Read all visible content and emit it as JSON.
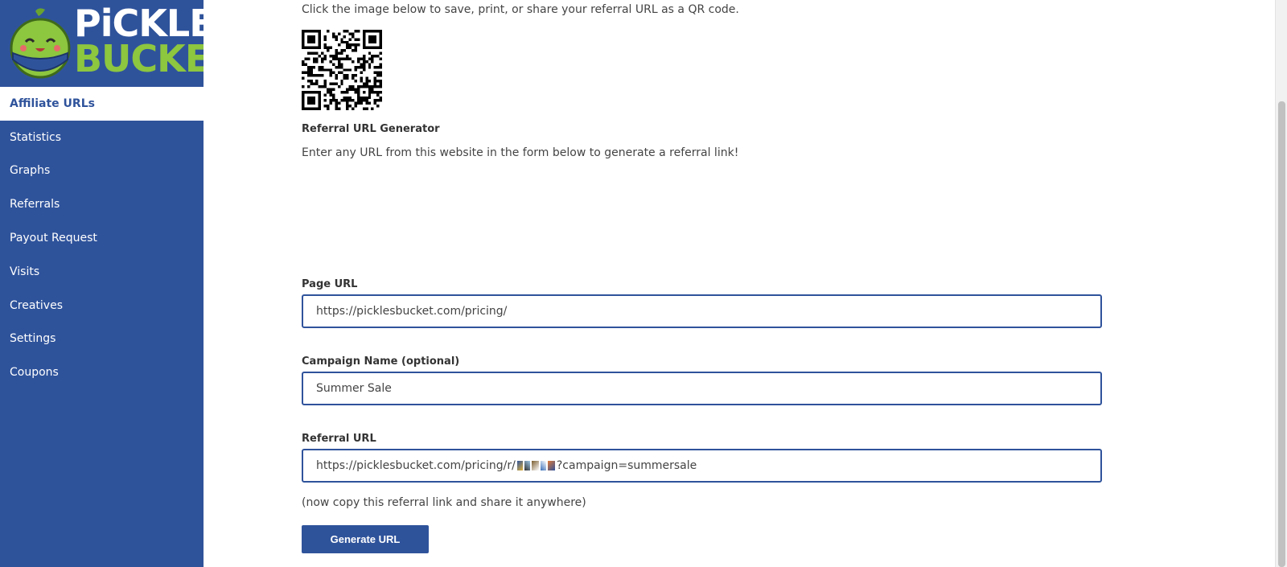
{
  "brand": {
    "line1": "PiCKLES",
    "line2": "BUCKET"
  },
  "sidebar": {
    "items": [
      {
        "label": "Affiliate URLs",
        "active": true
      },
      {
        "label": "Statistics"
      },
      {
        "label": "Graphs"
      },
      {
        "label": "Referrals"
      },
      {
        "label": "Payout Request"
      },
      {
        "label": "Visits"
      },
      {
        "label": "Creatives"
      },
      {
        "label": "Settings"
      },
      {
        "label": "Coupons"
      }
    ]
  },
  "main": {
    "qr_instructions": "Click the image below to save, print, or share your referral URL as a QR code.",
    "generator_title": "Referral URL Generator",
    "generator_desc": "Enter any URL from this website in the form below to generate a referral link!",
    "page_url_label": "Page URL",
    "page_url_value": "https://picklesbucket.com/pricing/",
    "campaign_label": "Campaign Name (optional)",
    "campaign_value": "Summer Sale",
    "referral_label": "Referral URL",
    "referral_value_prefix": "https://picklesbucket.com/pricing/r/",
    "referral_value_suffix": "?campaign=summersale",
    "copy_hint": "(now copy this referral link and share it anywhere)",
    "generate_button": "Generate URL"
  },
  "colors": {
    "brand_blue": "#2f539b",
    "brand_green": "#8dc63f"
  }
}
